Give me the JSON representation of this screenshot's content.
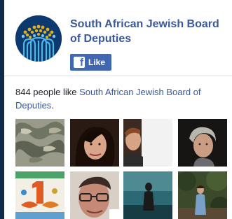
{
  "page": {
    "name": "South African Jewish Board of Deputies"
  },
  "like_button": {
    "icon": "facebook-f-icon",
    "icon_glyph": "f",
    "label": "Like"
  },
  "likes": {
    "count_text": "844 people like",
    "page_link": "South African Jewish Board of Deputies",
    "end": "."
  },
  "faces": [
    {
      "name": "camouflage"
    },
    {
      "name": "woman-dark-hair"
    },
    {
      "name": "man-portrait"
    },
    {
      "name": "older-woman"
    },
    {
      "name": "number-one-graphic"
    },
    {
      "name": "man-glasses"
    },
    {
      "name": "person-by-water"
    },
    {
      "name": "person-in-garden"
    }
  ]
}
